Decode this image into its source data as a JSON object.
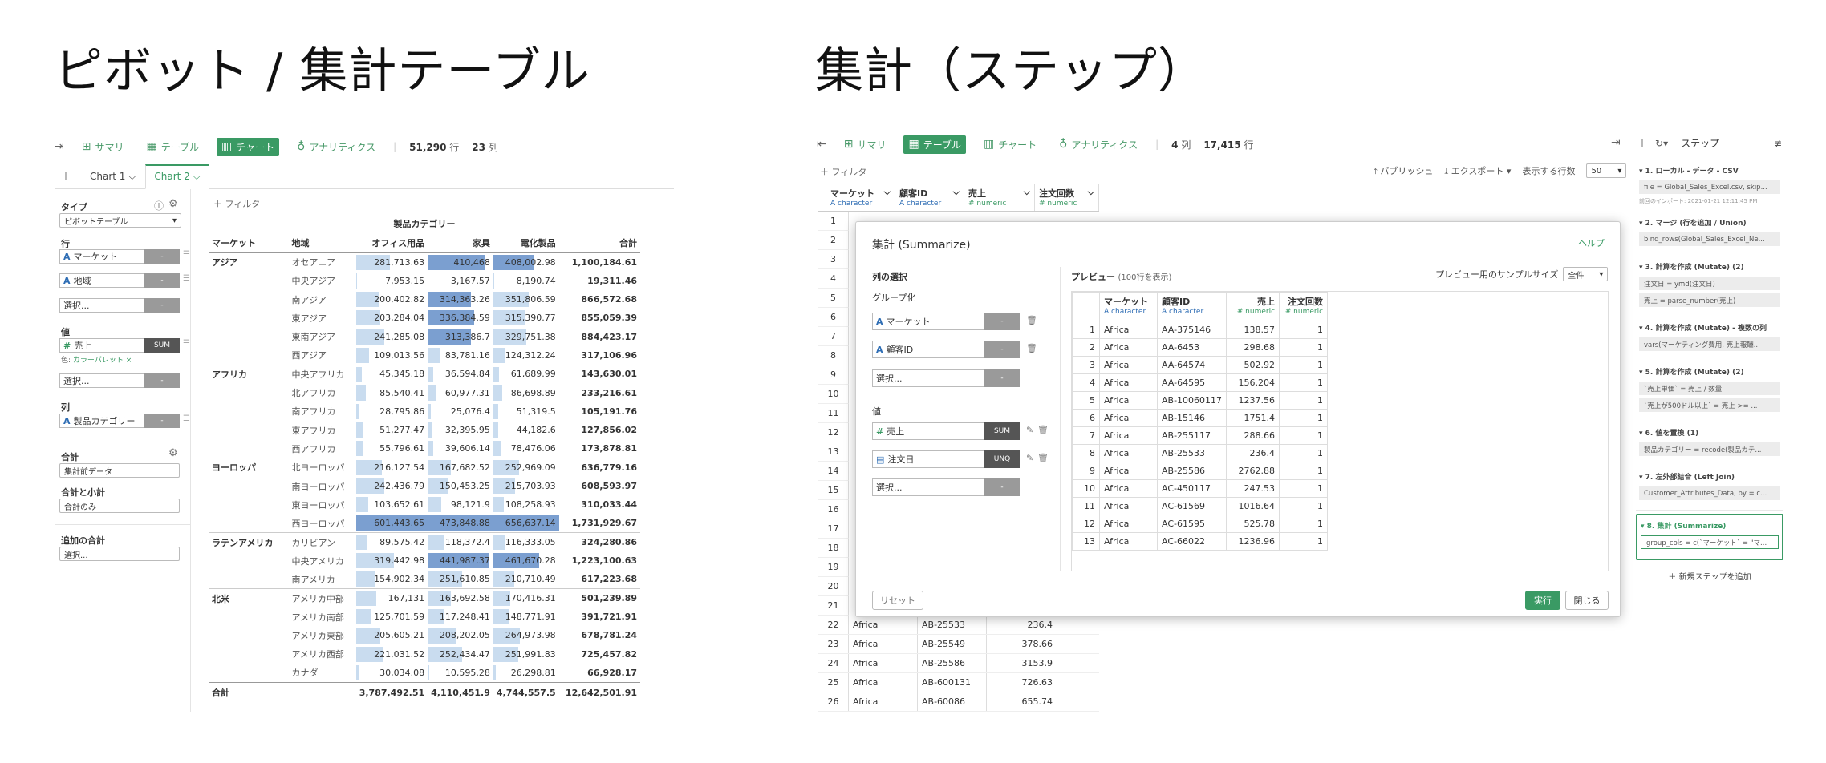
{
  "left": {
    "title": "ピボット / 集計テーブル",
    "toolbar": {
      "summary": "サマリ",
      "table": "テーブル",
      "chart": "チャート",
      "analytics": "アナリティクス",
      "rows": "51,290",
      "rows_unit": "行",
      "cols": "23",
      "cols_unit": "列"
    },
    "tabs": [
      "Chart 1",
      "Chart 2"
    ],
    "config": {
      "type_label": "タイプ",
      "type_value": "ピボットテーブル",
      "row_label": "行",
      "row1": "マーケット",
      "row2": "地域",
      "select": "選択...",
      "value_label": "値",
      "value_field": "売上",
      "value_agg": "SUM",
      "color_label": "色:",
      "color_value": "カラーパレット",
      "col_label": "列",
      "col_field": "製品カテゴリー",
      "total_label": "合計",
      "total_value": "集計前データ",
      "subtotal_label": "合計と小計",
      "subtotal_value": "合計のみ",
      "extra_label": "追加の合計",
      "extra_value": "選択..."
    },
    "filter": "フィルタ",
    "pivot": {
      "col_group": "製品カテゴリー",
      "headers": [
        "マーケット",
        "地域",
        "オフィス用品",
        "家具",
        "電化製品",
        "合計"
      ],
      "rows": [
        [
          "アジア",
          "オセアニア",
          "281,713.63",
          "410,468",
          "408,002.98",
          "1,100,184.61"
        ],
        [
          "",
          "中央アジア",
          "7,953.15",
          "3,167.57",
          "8,190.74",
          "19,311.46"
        ],
        [
          "",
          "南アジア",
          "200,402.82",
          "314,363.26",
          "351,806.59",
          "866,572.68"
        ],
        [
          "",
          "東アジア",
          "203,284.04",
          "336,384.59",
          "315,390.77",
          "855,059.39"
        ],
        [
          "",
          "東南アジア",
          "241,285.08",
          "313,386.7",
          "329,751.38",
          "884,423.17"
        ],
        [
          "",
          "西アジア",
          "109,013.56",
          "83,781.16",
          "124,312.24",
          "317,106.96"
        ],
        [
          "アフリカ",
          "中央アフリカ",
          "45,345.18",
          "36,594.84",
          "61,689.99",
          "143,630.01"
        ],
        [
          "",
          "北アフリカ",
          "85,540.41",
          "60,977.31",
          "86,698.89",
          "233,216.61"
        ],
        [
          "",
          "南アフリカ",
          "28,795.86",
          "25,076.4",
          "51,319.5",
          "105,191.76"
        ],
        [
          "",
          "東アフリカ",
          "51,277.47",
          "32,395.95",
          "44,182.6",
          "127,856.02"
        ],
        [
          "",
          "西アフリカ",
          "55,796.61",
          "39,606.14",
          "78,476.06",
          "173,878.81"
        ],
        [
          "ヨーロッパ",
          "北ヨーロッパ",
          "216,127.54",
          "167,682.52",
          "252,969.09",
          "636,779.16"
        ],
        [
          "",
          "南ヨーロッパ",
          "242,436.79",
          "150,453.25",
          "215,703.93",
          "608,593.97"
        ],
        [
          "",
          "東ヨーロッパ",
          "103,652.61",
          "98,121.9",
          "108,258.93",
          "310,033.44"
        ],
        [
          "",
          "西ヨーロッパ",
          "601,443.65",
          "473,848.88",
          "656,637.14",
          "1,731,929.67"
        ],
        [
          "ラテンアメリカ",
          "カリビアン",
          "89,575.42",
          "118,372.4",
          "116,333.05",
          "324,280.86"
        ],
        [
          "",
          "中央アメリカ",
          "319,442.98",
          "441,987.37",
          "461,670.28",
          "1,223,100.63"
        ],
        [
          "",
          "南アメリカ",
          "154,902.34",
          "251,610.85",
          "210,710.49",
          "617,223.68"
        ],
        [
          "北米",
          "アメリカ中部",
          "167,131",
          "163,692.58",
          "170,416.31",
          "501,239.89"
        ],
        [
          "",
          "アメリカ南部",
          "125,701.59",
          "117,248.41",
          "148,771.91",
          "391,721.91"
        ],
        [
          "",
          "アメリカ東部",
          "205,605.21",
          "208,202.05",
          "264,973.98",
          "678,781.24"
        ],
        [
          "",
          "アメリカ西部",
          "221,031.52",
          "252,434.47",
          "251,991.83",
          "725,457.82"
        ],
        [
          "",
          "カナダ",
          "30,034.08",
          "10,595.28",
          "26,298.81",
          "66,928.17"
        ]
      ],
      "total": [
        "合計",
        "",
        "3,787,492.51",
        "4,110,451.9",
        "4,744,557.5",
        "12,642,501.91"
      ],
      "bars": [
        [
          0.47,
          0.87,
          0.62
        ],
        [
          0.01,
          0.01,
          0.01
        ],
        [
          0.33,
          0.66,
          0.54
        ],
        [
          0.34,
          0.71,
          0.48
        ],
        [
          0.4,
          0.66,
          0.5
        ],
        [
          0.18,
          0.18,
          0.19
        ],
        [
          0.08,
          0.08,
          0.09
        ],
        [
          0.14,
          0.13,
          0.13
        ],
        [
          0.05,
          0.05,
          0.08
        ],
        [
          0.09,
          0.07,
          0.07
        ],
        [
          0.09,
          0.08,
          0.12
        ],
        [
          0.36,
          0.35,
          0.39
        ],
        [
          0.4,
          0.32,
          0.33
        ],
        [
          0.17,
          0.21,
          0.16
        ],
        [
          1.0,
          1.0,
          1.0
        ],
        [
          0.15,
          0.25,
          0.18
        ],
        [
          0.53,
          0.93,
          0.7
        ],
        [
          0.26,
          0.53,
          0.32
        ],
        [
          0.28,
          0.35,
          0.26
        ],
        [
          0.21,
          0.25,
          0.23
        ],
        [
          0.34,
          0.44,
          0.4
        ],
        [
          0.37,
          0.53,
          0.38
        ],
        [
          0.05,
          0.02,
          0.04
        ]
      ]
    }
  },
  "right": {
    "title": "集計（ステップ）",
    "toolbar": {
      "summary": "サマリ",
      "table": "テーブル",
      "chart": "チャート",
      "analytics": "アナリティクス",
      "cols": "4",
      "cols_unit": "列",
      "rows": "17,415",
      "rows_unit": "行"
    },
    "filter": "フィルタ",
    "publish": "パブリッシュ",
    "export": "エクスポート",
    "rows_shown_label": "表示する行数",
    "rows_shown": "50",
    "grid": {
      "headers": [
        {
          "name": "マーケット",
          "type": "character"
        },
        {
          "name": "顧客ID",
          "type": "character"
        },
        {
          "name": "売上",
          "type": "numeric"
        },
        {
          "name": "注文回数",
          "type": "numeric"
        }
      ],
      "bottom_rows": [
        [
          "22",
          "Africa",
          "AB-25533",
          "236.4",
          "1"
        ],
        [
          "23",
          "Africa",
          "AB-25549",
          "378.66",
          "1"
        ],
        [
          "24",
          "Africa",
          "AB-25586",
          "3153.9",
          "2"
        ],
        [
          "25",
          "Africa",
          "AB-600131",
          "726.63",
          "1"
        ],
        [
          "26",
          "Africa",
          "AB-60086",
          "655.74",
          "2"
        ]
      ],
      "row_numbers": [
        "1",
        "2",
        "3",
        "4",
        "5",
        "6",
        "7",
        "8",
        "9",
        "10",
        "11",
        "12",
        "13",
        "14",
        "15",
        "16",
        "17",
        "18",
        "19",
        "20",
        "21"
      ]
    },
    "dialog": {
      "title": "集計 (Summarize)",
      "help": "ヘルプ",
      "col_select": "列の選択",
      "group_label": "グループ化",
      "group1": "マーケット",
      "group2": "顧客ID",
      "select": "選択...",
      "value_label": "値",
      "val1": "売上",
      "val1_agg": "SUM",
      "val2": "注文日",
      "val2_agg": "UNQ",
      "preview_label": "プレビュー",
      "preview_note": "(100行を表示)",
      "sample_label": "プレビュー用のサンプルサイズ",
      "sample_value": "全件",
      "preview_headers": [
        {
          "name": "マーケット",
          "type": "character"
        },
        {
          "name": "顧客ID",
          "type": "character"
        },
        {
          "name": "売上",
          "type": "numeric"
        },
        {
          "name": "注文回数",
          "type": "numeric"
        }
      ],
      "preview_rows": [
        [
          "1",
          "Africa",
          "AA-375146",
          "138.57",
          "1"
        ],
        [
          "2",
          "Africa",
          "AA-6453",
          "298.68",
          "1"
        ],
        [
          "3",
          "Africa",
          "AA-64574",
          "502.92",
          "1"
        ],
        [
          "4",
          "Africa",
          "AA-64595",
          "156.204",
          "1"
        ],
        [
          "5",
          "Africa",
          "AB-10060117",
          "1237.56",
          "1"
        ],
        [
          "6",
          "Africa",
          "AB-15146",
          "1751.4",
          "1"
        ],
        [
          "7",
          "Africa",
          "AB-255117",
          "288.66",
          "1"
        ],
        [
          "8",
          "Africa",
          "AB-25533",
          "236.4",
          "1"
        ],
        [
          "9",
          "Africa",
          "AB-25586",
          "2762.88",
          "1"
        ],
        [
          "10",
          "Africa",
          "AC-450117",
          "247.53",
          "1"
        ],
        [
          "11",
          "Africa",
          "AC-61569",
          "1016.64",
          "1"
        ],
        [
          "12",
          "Africa",
          "AC-61595",
          "525.78",
          "1"
        ],
        [
          "13",
          "Africa",
          "AC-66022",
          "1236.96",
          "1"
        ]
      ],
      "reset": "リセット",
      "run": "実行",
      "close": "閉じる"
    },
    "steps": {
      "title": "ステップ",
      "items": [
        {
          "head": "▾ 1. ローカル - データ - CSV",
          "boxes": [
            "file = Global_Sales_Excel.csv, skip..."
          ],
          "note": "前回のインポート: 2021-01-21 12:11:45 PM"
        },
        {
          "head": "▾ 2. マージ (行を追加 / Union)",
          "boxes": [
            "bind_rows(Global_Sales_Excel_Ne..."
          ]
        },
        {
          "head": "▾ 3. 計算を作成 (Mutate) (2)",
          "boxes": [
            "注文日 = ymd(注文日)",
            "売上 = parse_number(売上)"
          ]
        },
        {
          "head": "▾ 4. 計算を作成 (Mutate) - 複数の列",
          "boxes": [
            "vars(マーケティング費用, 売上報酬..."
          ]
        },
        {
          "head": "▾ 5. 計算を作成 (Mutate) (2)",
          "boxes": [
            "`売上単価` = 売上 / 数量",
            "`売上が500ドル以上` = 売上 >= ..."
          ]
        },
        {
          "head": "▾ 6. 値を置換 (1)",
          "boxes": [
            "製品カテゴリー = recode(製品カテ..."
          ]
        },
        {
          "head": "▾ 7. 左外部結合 (Left Join)",
          "boxes": [
            "Customer_Attributes_Data, by = c..."
          ]
        },
        {
          "head": "▾ 8. 集計 (Summarize)",
          "boxes": [
            "group_cols = c(`マーケット` = \"マ..."
          ]
        }
      ],
      "add": "新規ステップを追加"
    }
  }
}
